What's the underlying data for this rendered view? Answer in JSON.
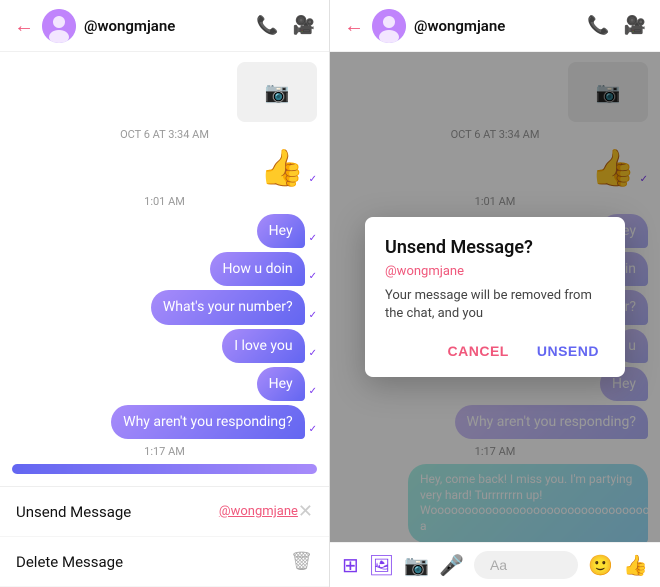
{
  "left": {
    "topbar": {
      "username": "@wongmjane",
      "back_icon": "←",
      "phone_icon": "📞",
      "video_icon": "📹"
    },
    "chat": {
      "date_label": "OCT 6 AT 3:34 AM",
      "time_label_1": "1:01 AM",
      "time_label_2": "1:17 AM",
      "messages": [
        {
          "id": 1,
          "text": "Hey",
          "type": "sent"
        },
        {
          "id": 2,
          "text": "How u doin",
          "type": "sent"
        },
        {
          "id": 3,
          "text": "What's your number?",
          "type": "sent"
        },
        {
          "id": 4,
          "text": "I love you",
          "type": "sent"
        },
        {
          "id": 5,
          "text": "Hey",
          "type": "sent"
        },
        {
          "id": 6,
          "text": "Why aren't you responding?",
          "type": "sent"
        }
      ]
    },
    "action_sheet": {
      "unsend_label": "Unsend Message",
      "unsend_tag": "@wongmjane",
      "delete_label": "Delete Message"
    }
  },
  "right": {
    "topbar": {
      "username": "@wongmjane",
      "back_icon": "←",
      "phone_icon": "📞",
      "video_icon": "📹"
    },
    "chat": {
      "date_label": "OCT 6 AT 3:34 AM",
      "time_label_1": "1:01 AM",
      "time_label_2": "1:17 AM",
      "messages": [
        {
          "id": 1,
          "text": "Hey",
          "type": "sent"
        },
        {
          "id": 2,
          "text": "doin",
          "type": "sent"
        },
        {
          "id": 3,
          "text": "er?",
          "type": "sent"
        },
        {
          "id": 4,
          "text": "u",
          "type": "sent"
        },
        {
          "id": 5,
          "text": "Hey",
          "type": "sent"
        },
        {
          "id": 6,
          "text": "Why aren't you responding?",
          "type": "sent"
        },
        {
          "id": 7,
          "text": "Hey, come back! I miss you. I'm partying very hard! Turrrrrrrn up! Woooooooooooooooooooooooooooooooooooo a",
          "type": "sent-teal"
        }
      ]
    },
    "dialog": {
      "title": "Unsend Message?",
      "username": "@wongmjane",
      "body": "Your message will be removed from the chat, and you",
      "cancel_label": "CANCEL",
      "unsend_label": "UNSEND"
    },
    "toolbar": {
      "aa_placeholder": "Aa"
    }
  }
}
